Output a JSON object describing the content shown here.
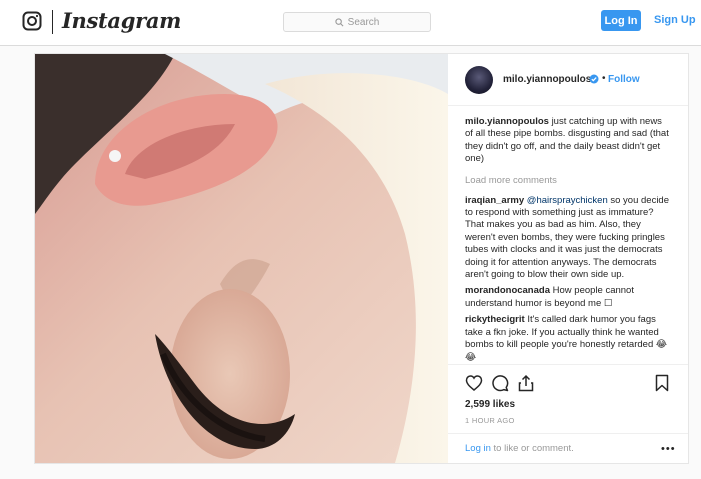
{
  "nav": {
    "brand": "Instagram",
    "search_placeholder": "Search",
    "login_label": "Log In",
    "signup_label": "Sign Up"
  },
  "post": {
    "username": "milo.yiannopoulos",
    "separator": "•",
    "follow_label": "Follow",
    "caption": {
      "user": "milo.yiannopoulos",
      "text": "just catching up with news of all these pipe bombs. disgusting and sad (that they didn't go off, and the daily beast didn't get one)"
    },
    "load_more_label": "Load more comments",
    "comments": [
      {
        "user": "iraqian_army",
        "mention": "@hairspraychicken",
        "text": "so you decide to respond with something just as immature? That makes you as bad as him. Also, they weren't even bombs, they were fucking pringles tubes with clocks and it was just the democrats doing it for attention anyways. The democrats aren't going to blow their own side up."
      },
      {
        "user": "morandonocanada",
        "text": "How people cannot understand humor is beyond me ☐"
      },
      {
        "user": "rickythecigrit",
        "text": "It's called dark humor you fags take a fkn joke. If you actually think he wanted bombs to kill people you're honestly retarded 😂😂"
      }
    ],
    "likes": "2,599 likes",
    "time": "1 HOUR AGO",
    "login_link": "Log in",
    "login_suffix": "to like or comment.",
    "more_label": "•••"
  },
  "colors": {
    "accent": "#3897f0",
    "text": "#262626",
    "muted": "#999999",
    "border": "#dbdbdb"
  },
  "icons": [
    "instagram-camera-icon",
    "search-icon",
    "verified-badge-icon",
    "heart-icon",
    "comment-icon",
    "share-icon",
    "bookmark-icon",
    "more-options-icon"
  ]
}
